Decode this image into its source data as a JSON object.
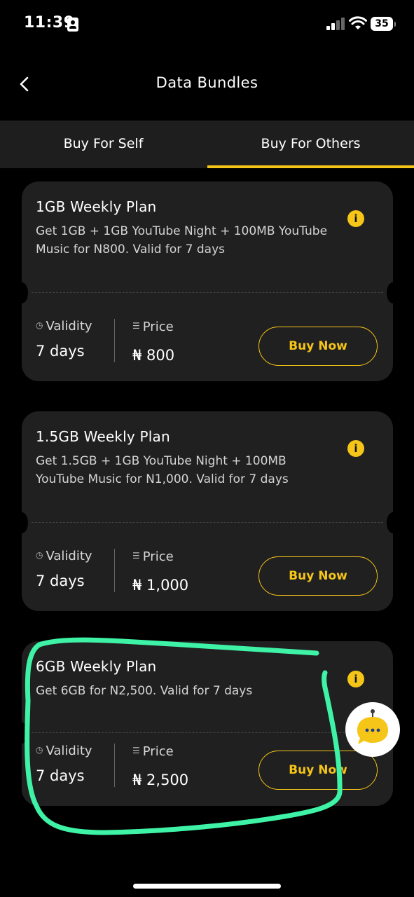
{
  "status_bar": {
    "time": "11:39",
    "battery": "35"
  },
  "header": {
    "title": "Data Bundles"
  },
  "tabs": [
    {
      "label": "Buy For Self",
      "active": false
    },
    {
      "label": "Buy For Others",
      "active": true
    }
  ],
  "labels": {
    "validity": "Validity",
    "price": "Price",
    "buy_now": "Buy Now"
  },
  "plans": [
    {
      "title": "1GB Weekly Plan",
      "description": "Get 1GB + 1GB YouTube Night + 100MB YouTube Music for N800. Valid for 7 days",
      "validity": "7 days",
      "price": "₦ 800"
    },
    {
      "title": "1.5GB Weekly Plan",
      "description": "Get 1.5GB + 1GB YouTube Night + 100MB YouTube Music for N1,000. Valid for 7 days",
      "validity": "7 days",
      "price": "₦ 1,000"
    },
    {
      "title": "6GB Weekly Plan",
      "description": "Get 6GB for N2,500. Valid for 7 days",
      "validity": "7 days",
      "price": "₦ 2,500"
    }
  ],
  "colors": {
    "accent": "#f5c518",
    "card_background": "#202020",
    "tab_background": "#1e1e1e",
    "highlight_stroke": "#3ef2a6"
  },
  "icons": {
    "back": "chevron-left-icon",
    "info": "info-icon",
    "clock": "clock-icon",
    "price": "price-list-icon",
    "chat_bot": "chat-bot-icon"
  }
}
